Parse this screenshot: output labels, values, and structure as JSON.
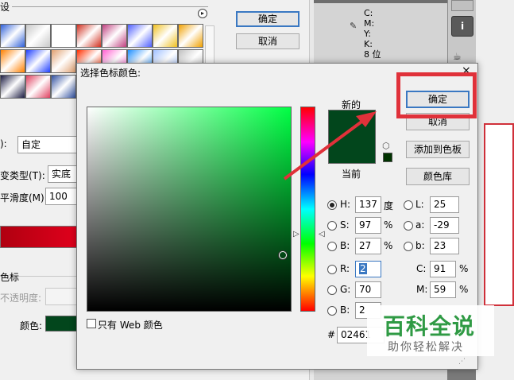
{
  "background_window": {
    "presets_label": "设",
    "ok_label": "确定",
    "cancel_label": "取消",
    "name_value": "自定",
    "gradient_type_label": "变类型(T):",
    "gradient_type_value": "实底",
    "smoothness_label": "平滑度(M):",
    "smoothness_value": "100",
    "color_stop_label": "色标",
    "opacity_label": "不透明度:",
    "color_label": "颜色:",
    "name_colon": "):",
    "swatch_colors": [
      "#2f60d8",
      "#c8c8c8",
      "#ffffff",
      "#d03020",
      "#c04080",
      "#5060ff",
      "#f0c020",
      "#f0a000",
      "#ff8000",
      "#2040ff",
      "#e0a070",
      "#ff3000",
      "#ff60d0",
      "#2090ff",
      "#a0c0ff",
      "#c0c0c0",
      "#1a1a40",
      "#e04060",
      "#3050a0",
      "#a0a040",
      "#4050c0",
      "#80a0d0",
      "#d8d8d8",
      "#d8d8d8"
    ]
  },
  "info_panel": {
    "lines": [
      "C:",
      "M:",
      "Y:",
      "K:",
      "8 位"
    ],
    "tool_icon": "info-icon",
    "tool_icon_glyph": "i"
  },
  "dialog": {
    "title": "选择色标颜色:",
    "close_glyph": "×",
    "new_label": "新的",
    "current_label": "当前",
    "new_color": "#02461c",
    "current_color": "#02461c",
    "buttons": {
      "ok": "确定",
      "cancel": "取消",
      "add_swatch": "添加到色板",
      "color_library": "颜色库"
    },
    "fields": {
      "H": {
        "label": "H:",
        "value": "137",
        "unit": "度"
      },
      "S": {
        "label": "S:",
        "value": "97",
        "unit": "%"
      },
      "Bv": {
        "label": "B:",
        "value": "27",
        "unit": "%"
      },
      "R": {
        "label": "R:",
        "value": "2"
      },
      "G": {
        "label": "G:",
        "value": "70"
      },
      "Bc": {
        "label": "B:",
        "value": "2"
      },
      "L": {
        "label": "L:",
        "value": "25"
      },
      "a": {
        "label": "a:",
        "value": "-29"
      },
      "b": {
        "label": "b:",
        "value": "23"
      },
      "C": {
        "label": "C:",
        "value": "91",
        "unit": "%"
      },
      "M": {
        "label": "M:",
        "value": "59",
        "unit": "%"
      },
      "hex": {
        "label": "#",
        "value": "02461"
      }
    },
    "web_only_label": "只有 Web 颜色",
    "selected_mode": "H"
  },
  "watermark": {
    "title": "百科全说",
    "subtitle": "助你轻松解决"
  },
  "colors": {
    "annotation_red": "#e0313a",
    "accent_blue": "#3a78c2"
  }
}
